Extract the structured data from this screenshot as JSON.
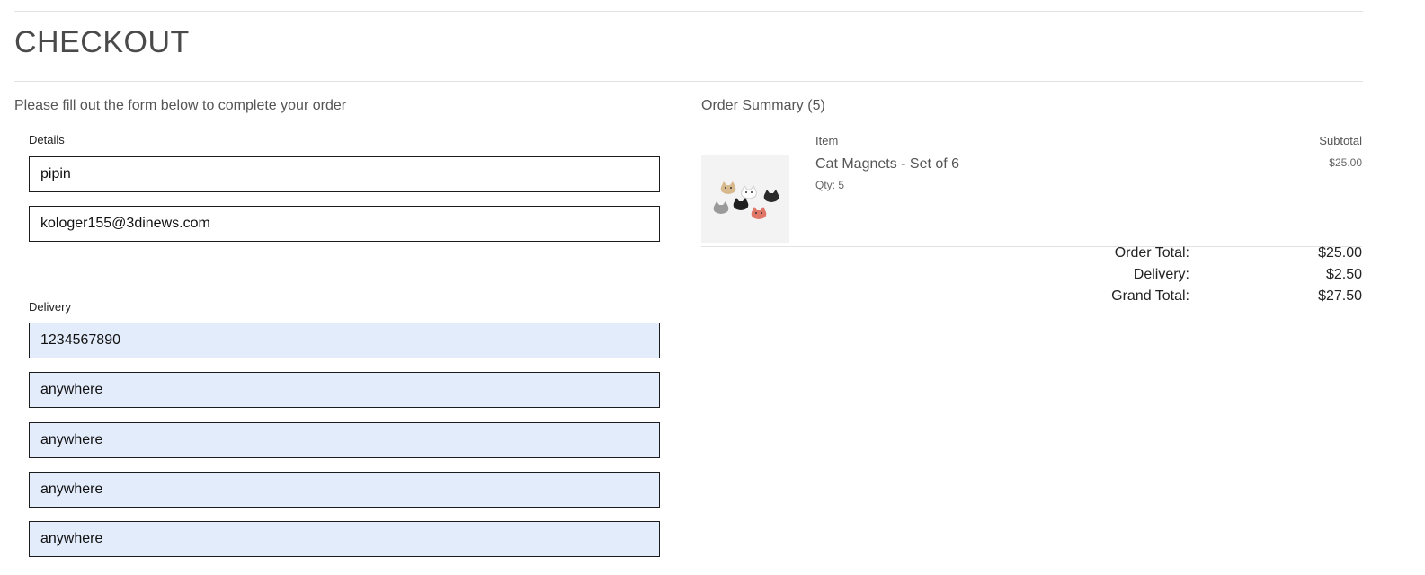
{
  "page": {
    "title": "CHECKOUT",
    "intro": "Please fill out the form below to complete your order"
  },
  "form": {
    "details_label": "Details",
    "details_fields": [
      {
        "value": "pipin"
      },
      {
        "value": "kologer155@3dinews.com"
      }
    ],
    "delivery_label": "Delivery",
    "delivery_fields": [
      {
        "value": "1234567890"
      },
      {
        "value": "anywhere"
      },
      {
        "value": "anywhere"
      },
      {
        "value": "anywhere"
      },
      {
        "value": "anywhere"
      }
    ]
  },
  "summary": {
    "title": "Order Summary (5)",
    "columns": {
      "item": "Item",
      "subtotal": "Subtotal"
    },
    "items": [
      {
        "name": "Cat Magnets - Set of 6",
        "qty": "Qty: 5",
        "subtotal": "$25.00",
        "image_icon": "cat-magnets-image"
      }
    ],
    "totals": [
      {
        "label": "Order Total:",
        "value": "$25.00"
      },
      {
        "label": "Delivery:",
        "value": "$2.50"
      },
      {
        "label": "Grand Total:",
        "value": "$27.50"
      }
    ]
  },
  "colors": {
    "filled_field_bg": "#e3ecfb",
    "field_border": "#1c1c1c",
    "rule": "#e2e2e2"
  }
}
